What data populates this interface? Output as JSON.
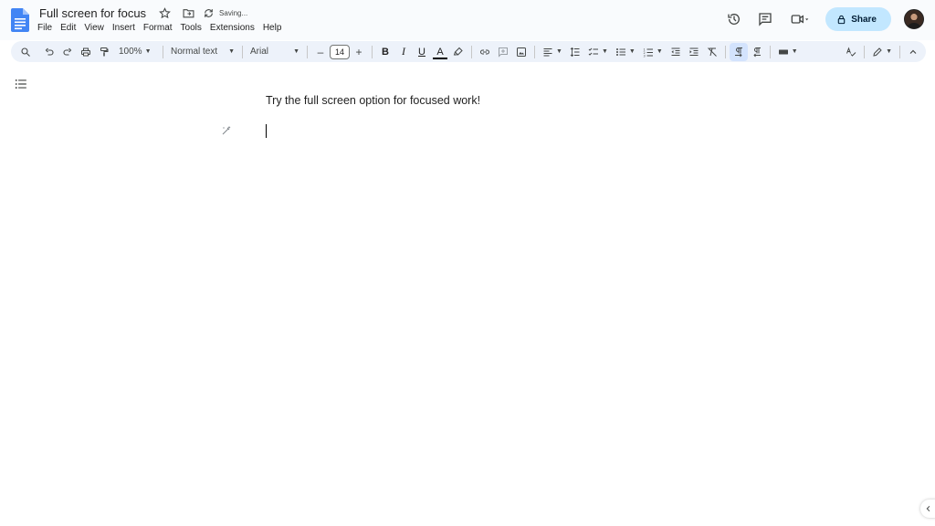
{
  "document": {
    "title": "Full screen for focus",
    "status": "Saving...",
    "body_text": "Try the full screen option for focused work!"
  },
  "menu": [
    {
      "label": "File"
    },
    {
      "label": "Edit"
    },
    {
      "label": "View"
    },
    {
      "label": "Insert"
    },
    {
      "label": "Format"
    },
    {
      "label": "Tools"
    },
    {
      "label": "Extensions"
    },
    {
      "label": "Help"
    }
  ],
  "header": {
    "share_label": "Share"
  },
  "toolbar": {
    "zoom": "100%",
    "paragraph_style": "Normal text",
    "font": "Arial",
    "font_size": "14",
    "bold_glyph": "B",
    "italic_glyph": "I",
    "underline_glyph": "U",
    "text_color_glyph": "A",
    "decrease_glyph": "–",
    "increase_glyph": "+"
  },
  "colors": {
    "header_bg": "#f9fbfd",
    "toolbar_bg": "#edf2fa",
    "share_bg": "#c2e7ff",
    "doc_icon": "#4285f4",
    "active_tool_bg": "#d3e3fd"
  },
  "icons": [
    "docs-logo-icon",
    "star-icon",
    "move-folder-icon",
    "sync-icon",
    "version-history-icon",
    "comments-icon",
    "meet-icon",
    "lock-icon",
    "search-icon",
    "undo-icon",
    "redo-icon",
    "print-icon",
    "paint-format-icon",
    "highlight-icon",
    "link-icon",
    "add-comment-icon",
    "image-icon",
    "align-icon",
    "line-spacing-icon",
    "checklist-icon",
    "bullet-list-icon",
    "numbered-list-icon",
    "indent-decrease-icon",
    "indent-increase-icon",
    "clear-format-icon",
    "ltr-icon",
    "rtl-icon",
    "input-tools-icon",
    "spellcheck-icon",
    "editing-mode-icon",
    "collapse-icon",
    "outline-icon",
    "edit-hint-icon",
    "chevron-left-icon"
  ]
}
